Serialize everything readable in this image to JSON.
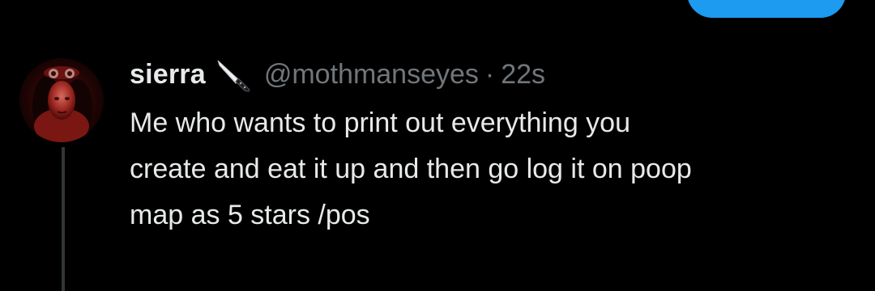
{
  "tweet": {
    "author_name": "sierra",
    "author_emoji_icon": "kitchen-knife-icon",
    "handle": "@mothmanseyes",
    "separator": "·",
    "timestamp": "22s",
    "text": "Me who wants to print out everything you\ncreate and eat it up and then go log it on poop\nmap as 5 stars /pos"
  },
  "colors": {
    "background": "#000000",
    "primary_text": "#e7e9ea",
    "secondary_text": "#71767b",
    "accent": "#1d9bf0",
    "thread_line": "#333639"
  }
}
